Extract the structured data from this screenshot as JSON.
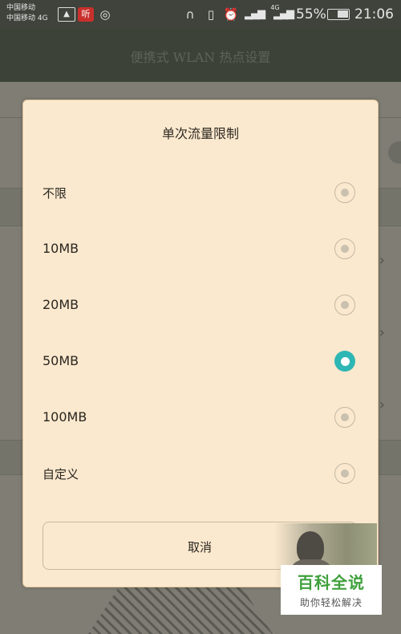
{
  "status_bar": {
    "carrier_1": "中国移动",
    "carrier_2": "中国移动 4G",
    "network_tag": "4G",
    "battery": "55%",
    "time": "21:06"
  },
  "background": {
    "title": "便携式 WLAN 热点设置"
  },
  "dialog": {
    "title": "单次流量限制",
    "options": [
      {
        "label": "不限",
        "selected": false
      },
      {
        "label": "10MB",
        "selected": false
      },
      {
        "label": "20MB",
        "selected": false
      },
      {
        "label": "50MB",
        "selected": true
      },
      {
        "label": "100MB",
        "selected": false
      },
      {
        "label": "自定义",
        "selected": false
      }
    ],
    "cancel_label": "取消"
  },
  "watermark": {
    "title": "百科全说",
    "subtitle": "助你轻松解决"
  },
  "colors": {
    "accent": "#2eb6b4",
    "dialog_bg": "#fbe9cf",
    "status_bar_bg": "#3f433b"
  }
}
